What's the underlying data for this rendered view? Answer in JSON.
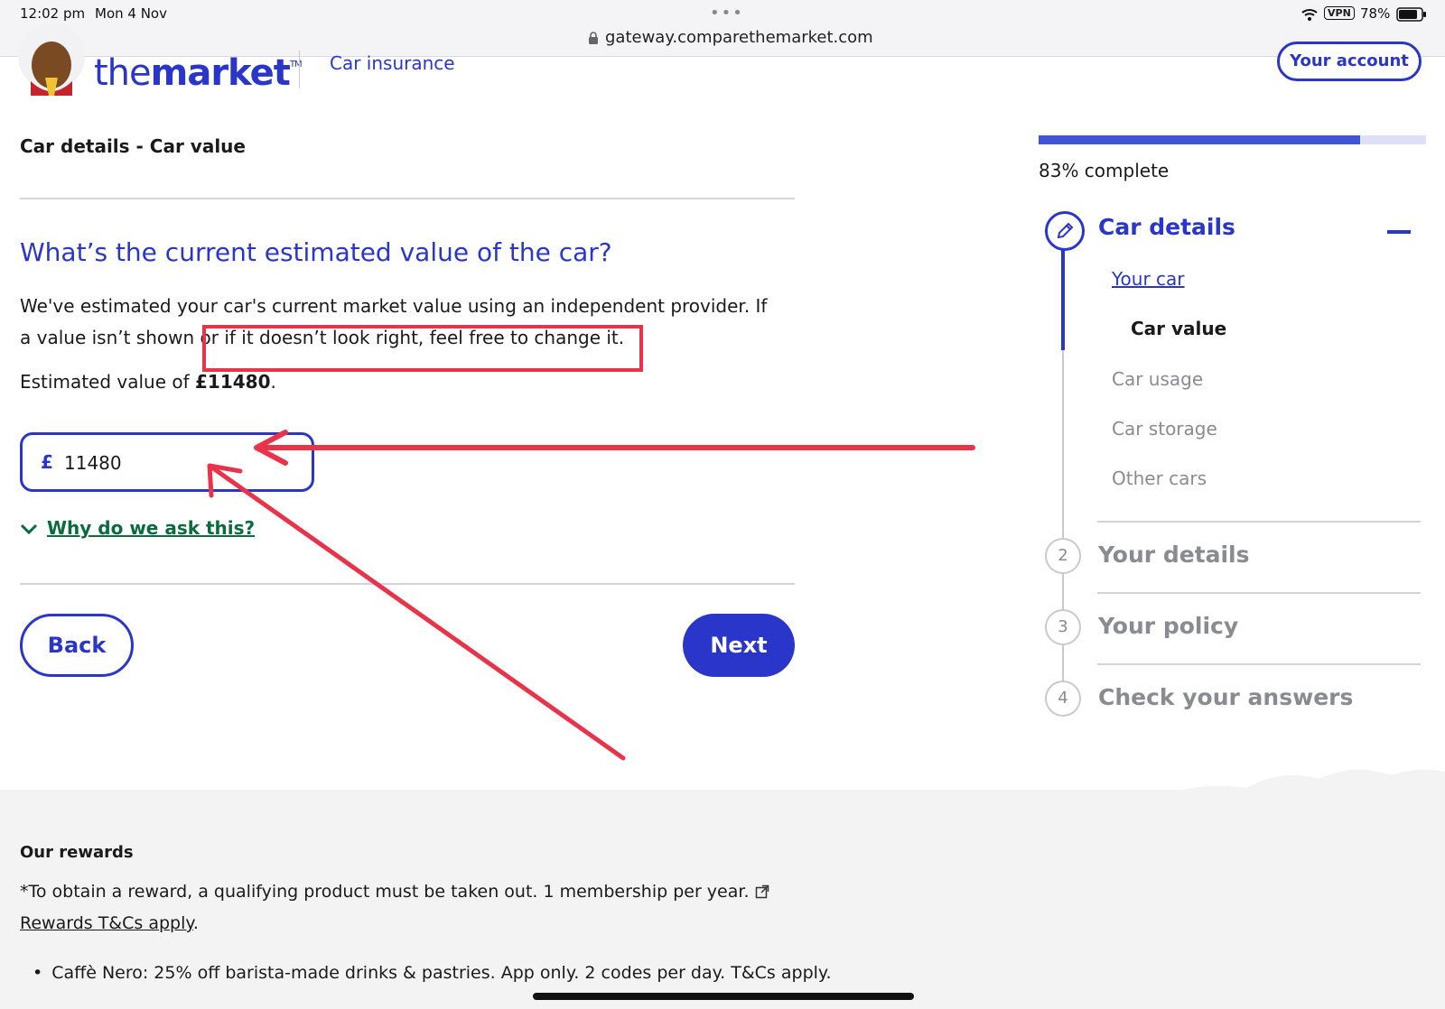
{
  "status_bar": {
    "time": "12:02 pm",
    "date": "Mon 4 Nov",
    "url": "gateway.comparethemarket.com",
    "vpn": "VPN",
    "battery": "78%"
  },
  "header": {
    "logo_word_light": "the",
    "logo_word_bold": "market",
    "logo_tm": "TM",
    "product": "Car insurance",
    "account_label": "Your account"
  },
  "form": {
    "breadcrumb": "Car details - Car value",
    "question": "What’s the current estimated value of the car?",
    "intro": "We've estimated your car's current market value using an independent provider. If a value isn’t shown or if it doesn’t look right, feel free to change it.",
    "estimate_prefix": "Estimated value of ",
    "estimate_value": "£11480",
    "estimate_suffix": ".",
    "currency_symbol": "£",
    "value": "11480",
    "why_label": "Why do we ask this?",
    "back_label": "Back",
    "next_label": "Next"
  },
  "sidebar": {
    "progress_percent": 83,
    "progress_text": "83% complete",
    "steps": [
      {
        "number": "1",
        "title": "Car details",
        "active": true,
        "sub_items": [
          {
            "label": "Your car",
            "state": "link"
          },
          {
            "label": "Car value",
            "state": "current"
          },
          {
            "label": "Car usage",
            "state": "pending"
          },
          {
            "label": "Car storage",
            "state": "pending"
          },
          {
            "label": "Other cars",
            "state": "pending"
          }
        ]
      },
      {
        "number": "2",
        "title": "Your details",
        "active": false
      },
      {
        "number": "3",
        "title": "Your policy",
        "active": false
      },
      {
        "number": "4",
        "title": "Check your answers",
        "active": false
      }
    ]
  },
  "footer": {
    "rewards_title": "Our rewards",
    "rewards_note_text": "*To obtain a reward, a qualifying product must be taken out. 1 membership per year. ",
    "rewards_link": "Rewards T&Cs apply",
    "rewards_note_end": ".",
    "bullets": [
      "Caffè Nero: 25% off barista-made drinks & pastries. App only. 2 codes per day. T&Cs apply."
    ]
  },
  "colors": {
    "brand_blue": "#2a36c9",
    "link_green": "#0a6b3d",
    "annotation_red": "#e8334a",
    "muted_grey": "#8a8a92"
  }
}
